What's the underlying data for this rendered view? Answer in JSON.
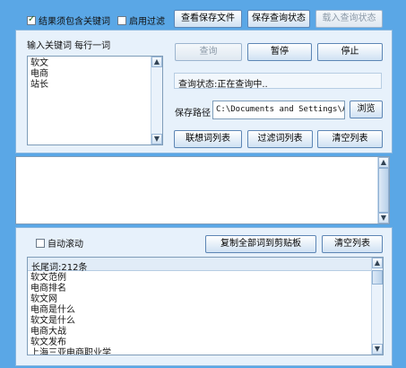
{
  "top": {
    "must_contain_keyword": {
      "label": "结果须包含关键词",
      "checked": true
    },
    "enable_filter": {
      "label": "启用过滤",
      "checked": false
    },
    "view_save_file": "查看保存文件",
    "save_query_status": "保存查询状态",
    "load_query_status": "载入查询状态"
  },
  "keywords": {
    "header": "输入关键词  每行一词",
    "items": [
      "软文",
      "电商",
      "站长"
    ]
  },
  "controls": {
    "query": "查询",
    "pause": "暂停",
    "stop": "停止",
    "status": "查询状态:正在查询中..",
    "save_path_label": "保存路径",
    "save_path_value": "C:\\Documents and Settings\\Adm",
    "browse": "浏览",
    "associated_list": "联想词列表",
    "filter_list": "过滤词列表",
    "clear_list": "清空列表"
  },
  "bottom": {
    "auto_scroll": {
      "label": "自动滚动",
      "checked": false
    },
    "copy_all": "复制全部词到剪贴板",
    "clear_list": "清空列表",
    "longtail_header": "长尾词:212条",
    "results": [
      "软文范例",
      "电商排名",
      "软文网",
      "电商是什么",
      "软文是什么",
      "电商大战",
      "软文发布",
      "上海三亚电商职业学"
    ]
  }
}
